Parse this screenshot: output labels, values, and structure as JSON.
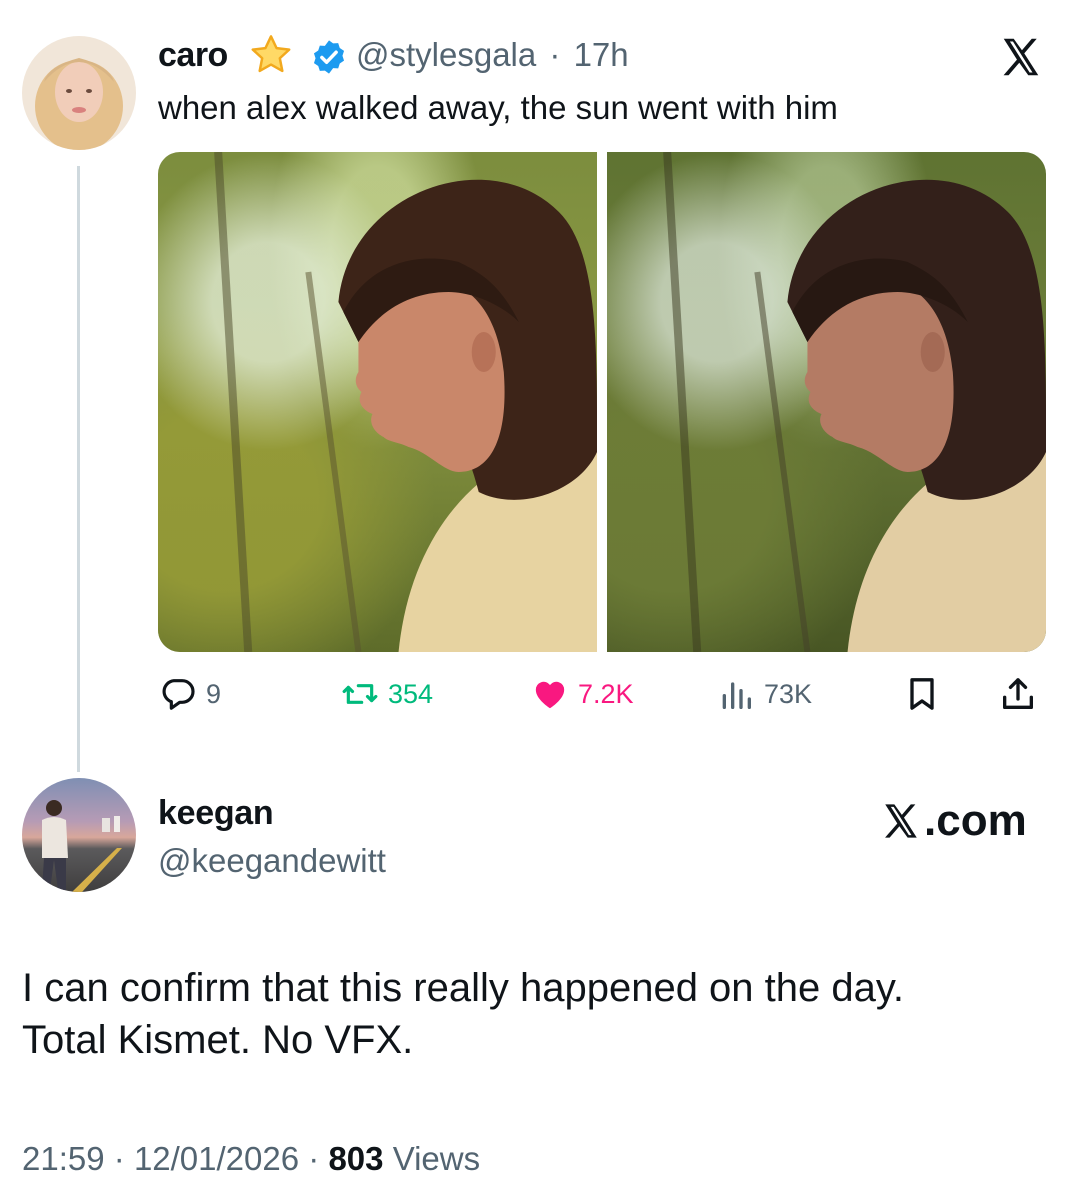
{
  "original_tweet": {
    "author_name": "caro",
    "handle": "@stylesgala",
    "separator": "·",
    "time_ago": "17h",
    "text": "when alex walked away, the sun went with him",
    "actions": {
      "replies": "9",
      "reposts": "354",
      "likes": "7.2K",
      "views": "73K"
    },
    "colors": {
      "repost_active": "#00ba7c",
      "like_active": "#f91880",
      "verified": "#1d9bf0",
      "muted": "#536471"
    }
  },
  "reply_tweet": {
    "author_name": "keegan",
    "handle": "@keegandewitt",
    "brand_text": ".com",
    "text_lines": [
      "I can confirm that this really happened on the day.",
      "Total Kismet. No VFX."
    ],
    "time": "21:59",
    "separator": "·",
    "date": "12/01/2026",
    "views_count": "803",
    "views_label": "Views"
  },
  "icons": {
    "badge": "star-icon",
    "verified": "verified-badge-icon",
    "logo": "x-logo-icon",
    "reply": "reply-icon",
    "repost": "repost-icon",
    "like": "heart-icon",
    "views": "views-icon",
    "bookmark": "bookmark-icon",
    "share": "share-icon"
  }
}
